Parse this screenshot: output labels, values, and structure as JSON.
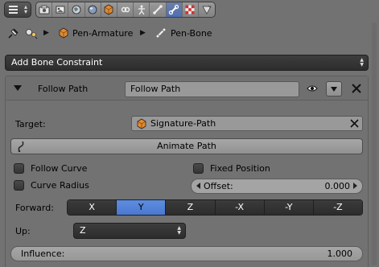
{
  "colors": {
    "panel_bg": "#727272",
    "active_tab": "#5a7fc2",
    "selected_axis": "#5680d8",
    "dark_button": "#333333"
  },
  "tabs": {
    "icons": [
      "render-icon",
      "scene-icon",
      "world-icon",
      "object-icon",
      "constraints-icon",
      "modifiers-icon",
      "data-icon",
      "bone-icon",
      "bone-constraint-icon",
      "material-icon",
      "texture-icon"
    ],
    "active": "bone-constraint-icon"
  },
  "breadcrumb": {
    "armature": "Pen-Armature",
    "bone": "Pen-Bone"
  },
  "add_constraint": {
    "label": "Add Bone Constraint"
  },
  "constraint": {
    "type_label": "Follow Path",
    "name": "Follow Path",
    "target_label": "Target:",
    "target_value": "Signature-Path",
    "animate_path": "Animate Path",
    "follow_curve": "Follow Curve",
    "curve_radius": "Curve Radius",
    "fixed_position": "Fixed Position",
    "offset_label": "Offset:",
    "offset_value": "0.000",
    "forward_label": "Forward:",
    "forward_options": [
      "X",
      "Y",
      "Z",
      "-X",
      "-Y",
      "-Z"
    ],
    "forward_selected": "Y",
    "up_label": "Up:",
    "up_value": "Z",
    "influence_label": "Influence:",
    "influence_value": "1.000"
  }
}
